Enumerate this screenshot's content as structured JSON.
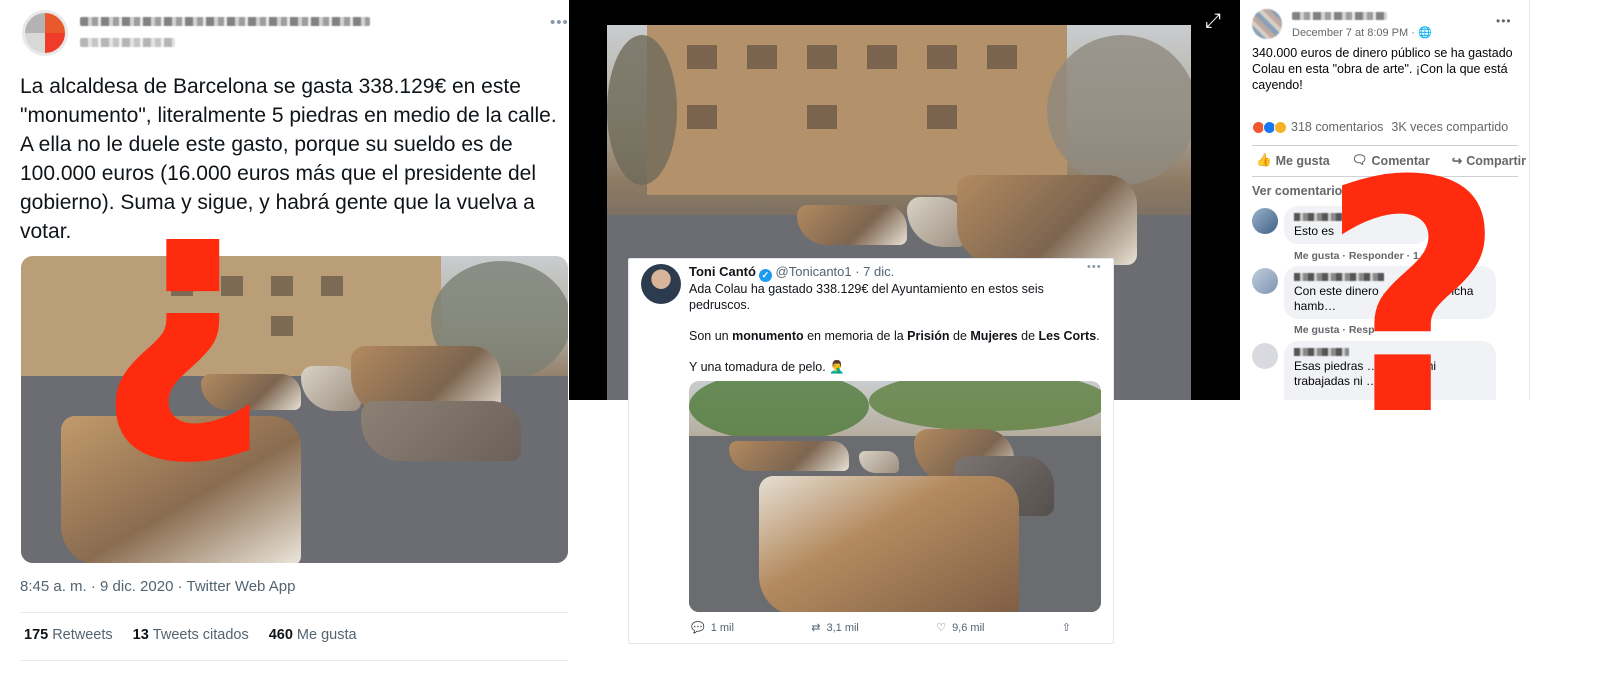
{
  "left_tweet": {
    "text": "La alcaldesa de Barcelona se gasta 338.129€ en este \"monumento\", literalmente 5 piedras en medio de la calle. A ella no le duele este gasto, porque su sueldo es de 100.000 euros (16.000 euros más que el presidente del gobierno). Suma y sigue, y habrá gente que la vuelva a votar.",
    "timestamp": "8:45 a. m. · 9 dic. 2020 · Twitter Web App",
    "retweets_count": "175",
    "retweets_label": "Retweets",
    "quotes_count": "13",
    "quotes_label": "Tweets citados",
    "likes_count": "460",
    "likes_label": "Me gusta",
    "more_icon": "more-dots-icon"
  },
  "embedded_tweet": {
    "name": "Toni Cantó",
    "handle": "@Tonicanto1 · 7 dic.",
    "line1": "Ada Colau ha gastado 338.129€ del Ayuntamiento en estos seis pedruscos.",
    "line2_pre": "Son un ",
    "line2_b1": "monumento",
    "line2_mid1": " en memoria de la ",
    "line2_b2": "Prisión",
    "line2_mid2": " de ",
    "line2_b3": "Mujeres",
    "line2_mid3": " de ",
    "line2_b4": "Les Corts",
    "line2_end": ".",
    "line3": "Y una tomadura de pelo. 🤦‍♂️",
    "replies": "1 mil",
    "retweets": "3,1 mil",
    "likes": "9,6 mil"
  },
  "facebook_post": {
    "date": "December 7 at 8:09 PM · 🌐",
    "text": "340.000 euros de dinero público se ha gastado Colau en esta \"obra de arte\". ¡Con la que está cayendo!",
    "comments_count": "318 comentarios",
    "shares_count": "3K veces compartido",
    "like_label": "Me gusta",
    "comment_label": "Comentar",
    "share_label": "Compartir",
    "previous_comments": "Ver comentarios anteriores",
    "comments": [
      {
        "text": "Esto es",
        "meta": "Me gusta · Responder · 1 d"
      },
      {
        "text": "Con este dinero … quitar muncha hamb…",
        "meta": "Me gusta · Resp"
      },
      {
        "text": "Esas piedras … talladas ni trabajadas ni … cómo"
      }
    ],
    "colors": {
      "reaction_angry": "#f0582f",
      "reaction_like": "#1877f2",
      "reaction_haha": "#f7b125"
    }
  },
  "overlay": {
    "inverted_question": "¿",
    "question": "?",
    "color": "#ff2b0f"
  },
  "expand_icon": "expand-arrows-icon"
}
